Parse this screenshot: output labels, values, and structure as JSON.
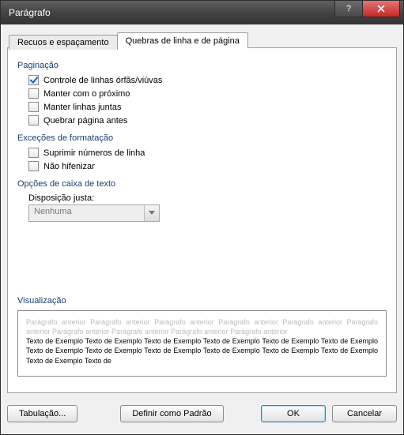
{
  "window": {
    "title": "Parágrafo"
  },
  "tabs": {
    "t1": "Recuos e espaçamento",
    "t2": "Quebras de linha e de página"
  },
  "pagination": {
    "legend": "Paginação",
    "widow": "Controle de linhas órfãs/viúvas",
    "keepNext": "Manter com o próximo",
    "keepLines": "Manter linhas juntas",
    "pageBreak": "Quebrar página antes"
  },
  "exceptions": {
    "legend": "Exceções de formatação",
    "suppress": "Suprimir números de linha",
    "noHyphen": "Não hifenizar"
  },
  "textbox": {
    "legend": "Opções de caixa de texto",
    "tightLabel": "Disposição justa:",
    "tightValue": "Nenhuma"
  },
  "preview": {
    "legend": "Visualização",
    "prev": "Parágrafo anterior Parágrafo anterior Parágrafo anterior Parágrafo anterior Parágrafo anterior Parágrafo anterior Parágrafo anterior Parágrafo anterior Parágrafo anterior Parágrafo anterior",
    "sample": "Texto de Exemplo Texto de Exemplo Texto de Exemplo Texto de Exemplo Texto de Exemplo Texto de Exemplo Texto de Exemplo Texto de Exemplo Texto de Exemplo Texto de Exemplo Texto de Exemplo Texto de Exemplo Texto de Exemplo Texto de"
  },
  "buttons": {
    "tabs": "Tabulação...",
    "default": "Definir como Padrão",
    "ok": "OK",
    "cancel": "Cancelar"
  }
}
